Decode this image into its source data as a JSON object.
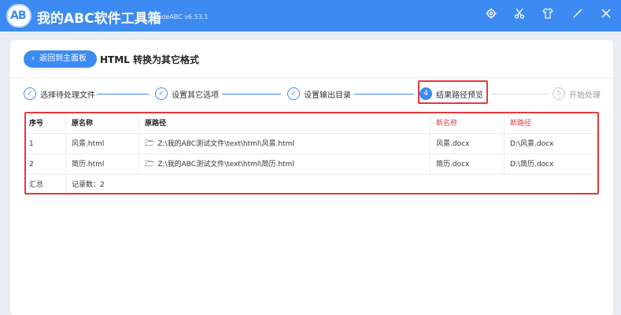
{
  "app": {
    "logo_text": "AB",
    "title": "我的ABC软件工具箱",
    "version": "WodeABC v6.53.1"
  },
  "titlebar_icons": [
    "gear-icon",
    "scissors-icon",
    "shirt-icon",
    "minimize-icon",
    "close-icon"
  ],
  "header": {
    "back_label": "返回到主面板",
    "page_title": "HTML 转换为其它格式"
  },
  "steps": [
    {
      "label": "选择待处理文件",
      "state": "done"
    },
    {
      "label": "设置其它选项",
      "state": "done"
    },
    {
      "label": "设置输出目录",
      "state": "done"
    },
    {
      "label": "结果路径预览",
      "state": "active",
      "number": "4"
    },
    {
      "label": "开始处理",
      "state": "todo",
      "number": "5"
    }
  ],
  "table": {
    "columns": [
      "序号",
      "原名称",
      "原路径",
      "新名称",
      "新路径"
    ],
    "rows": [
      {
        "index": "1",
        "name": "风景.html",
        "path": "Z:\\我的ABC测试文件\\text\\html\\风景.html",
        "new_name": "风景.docx",
        "new_path": "D:\\风景.docx"
      },
      {
        "index": "2",
        "name": "简历.html",
        "path": "Z:\\我的ABC测试文件\\text\\html\\简历.html",
        "new_name": "简历.docx",
        "new_path": "D:\\简历.docx"
      }
    ],
    "summary_label": "汇总",
    "summary_value": "记录数：2"
  },
  "colors": {
    "accent": "#3d8bf2",
    "highlight": "#e23a3a"
  }
}
